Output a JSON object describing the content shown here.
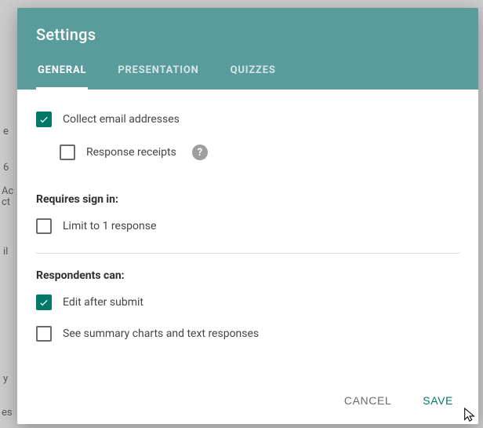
{
  "dialog": {
    "title": "Settings",
    "tabs": [
      {
        "label": "GENERAL",
        "active": true
      },
      {
        "label": "PRESENTATION",
        "active": false
      },
      {
        "label": "QUIZZES",
        "active": false
      }
    ]
  },
  "general": {
    "collect_email": {
      "label": "Collect email addresses",
      "checked": true
    },
    "response_receipts": {
      "label": "Response receipts",
      "checked": false
    },
    "requires_signin_header": "Requires sign in:",
    "limit_one": {
      "label": "Limit to 1 response",
      "checked": false
    },
    "respondents_can_header": "Respondents can:",
    "edit_after_submit": {
      "label": "Edit after submit",
      "checked": true
    },
    "see_summary": {
      "label": "See summary charts and text responses",
      "checked": false
    }
  },
  "footer": {
    "cancel": "CANCEL",
    "save": "SAVE"
  },
  "icons": {
    "help": "?"
  },
  "colors": {
    "header": "#5a9b9b",
    "accent": "#00796b",
    "text": "#3c3c3c"
  }
}
